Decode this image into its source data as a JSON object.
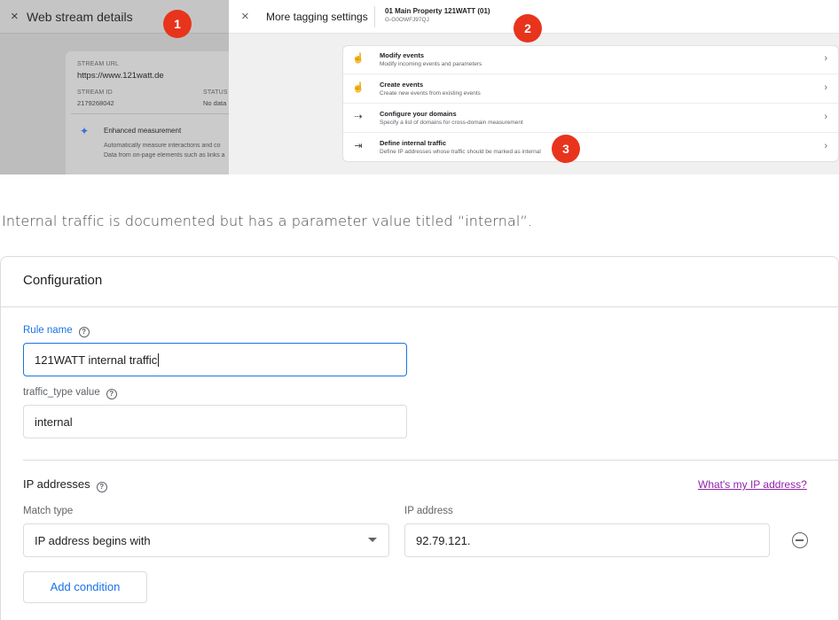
{
  "screenshot": {
    "web_stream": {
      "close_glyph": "×",
      "title": "Web stream details",
      "stream_url_label": "STREAM URL",
      "stream_url": "https://www.121watt.de",
      "stream_id_label": "STREAM ID",
      "stream_id": "2179268042",
      "status_label": "STATUS",
      "status": "No data",
      "enhanced_title": "Enhanced measurement",
      "enhanced_desc_1": "Automatically measure interactions and co",
      "enhanced_desc_2": "Data from on-page elements such as links a"
    },
    "tagging": {
      "close_glyph": "×",
      "title": "More tagging settings",
      "property_name": "01 Main Property 121WATT (01)",
      "property_id": "G-G0OWFJ97QJ",
      "items": [
        {
          "title": "Modify events",
          "desc": "Modify incoming events and parameters",
          "icon": "hand-pointer-icon"
        },
        {
          "title": "Create events",
          "desc": "Create new events from existing events",
          "icon": "hand-pointer-icon"
        },
        {
          "title": "Configure your domains",
          "desc": "Specify a list of domains for cross-domain measurement",
          "icon": "arrows-icon"
        },
        {
          "title": "Define internal traffic",
          "desc": "Define IP addresses whose traffic should be marked as internal",
          "icon": "login-icon"
        }
      ]
    },
    "badges": [
      "1",
      "2",
      "3"
    ],
    "badge_color": "#e8341c"
  },
  "caption": "Internal traffic is documented but has a parameter value titled “internal”.",
  "config": {
    "title": "Configuration",
    "rule_name_label": "Rule name",
    "rule_name_value": "121WATT internal traffic",
    "traffic_type_label": "traffic_type value",
    "traffic_type_value": "internal",
    "ip_section_title": "IP addresses",
    "whats_my_ip": "What's my IP address?",
    "match_type_label": "Match type",
    "match_type_value": "IP address begins with",
    "ip_address_label": "IP address",
    "ip_address_value": "92.79.121.",
    "add_condition": "Add condition",
    "accent_color": "#1a73e8",
    "link_color": "#8e24aa"
  }
}
